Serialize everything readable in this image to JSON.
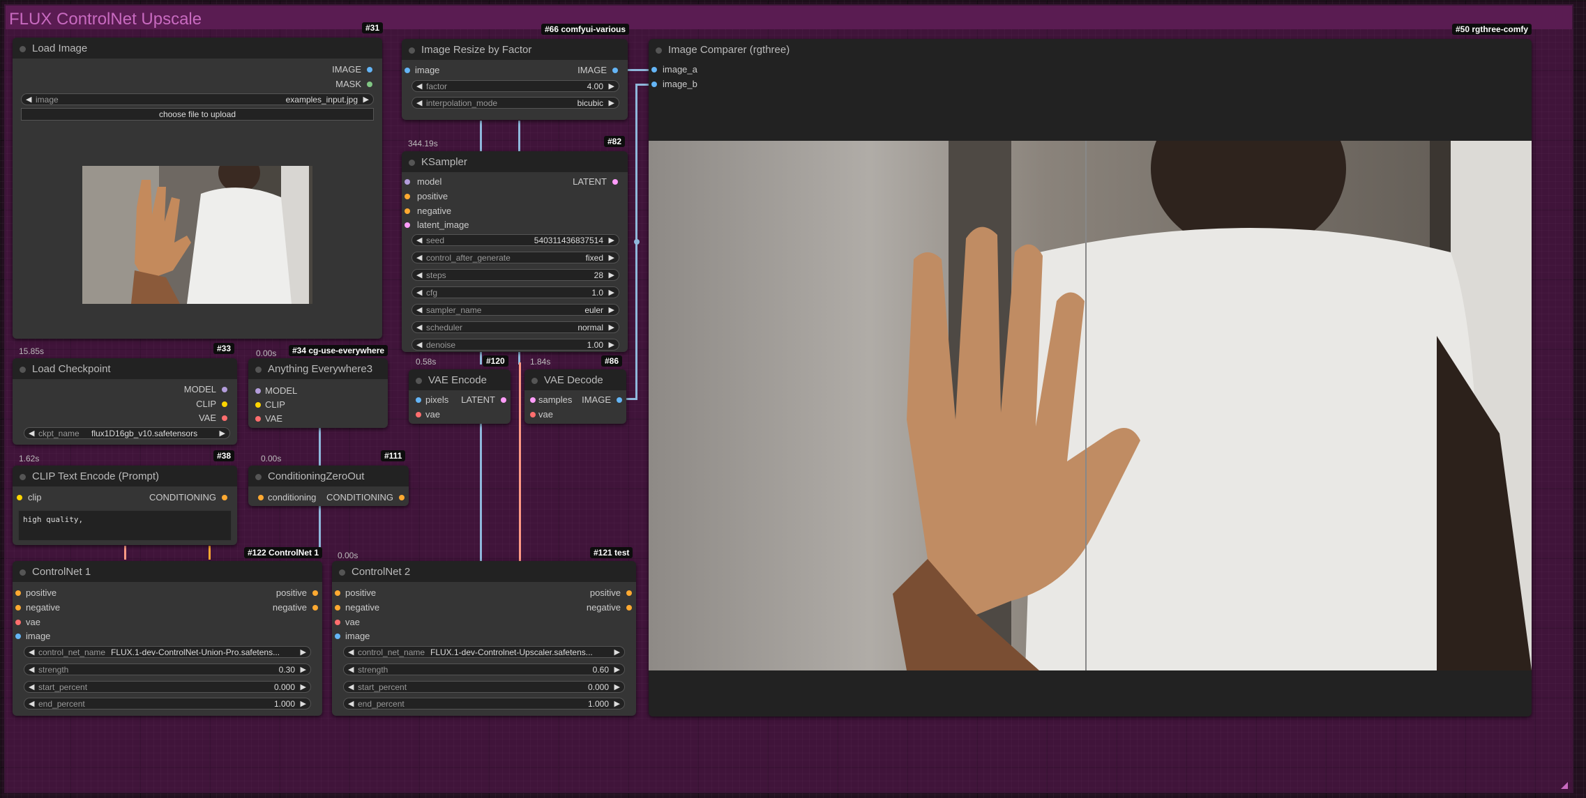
{
  "group": {
    "title": "FLUX ControlNet Upscale"
  },
  "nodes": {
    "load_image": {
      "title": "Load Image",
      "badge": "#31",
      "time": "15.85s",
      "outputs": [
        "IMAGE",
        "MASK"
      ],
      "widget_image": {
        "label": "image",
        "value": "examples_input.jpg"
      },
      "upload_label": "choose file to upload"
    },
    "resize": {
      "title": "Image Resize by Factor",
      "badge": "#66 comfyui-various",
      "input": "image",
      "output": "IMAGE",
      "factor": {
        "label": "factor",
        "value": "4.00"
      },
      "interp": {
        "label": "interpolation_mode",
        "value": "bicubic"
      }
    },
    "comparer": {
      "title": "Image Comparer (rgthree)",
      "badge": "#50 rgthree-comfy",
      "inputs": [
        "image_a",
        "image_b"
      ]
    },
    "ksampler": {
      "title": "KSampler",
      "badge": "#82",
      "time": "344.19s",
      "inputs": [
        "model",
        "positive",
        "negative",
        "latent_image"
      ],
      "output": "LATENT",
      "widgets": [
        {
          "label": "seed",
          "value": "540311436837514"
        },
        {
          "label": "control_after_generate",
          "value": "fixed"
        },
        {
          "label": "steps",
          "value": "28"
        },
        {
          "label": "cfg",
          "value": "1.0"
        },
        {
          "label": "sampler_name",
          "value": "euler"
        },
        {
          "label": "scheduler",
          "value": "normal"
        },
        {
          "label": "denoise",
          "value": "1.00"
        }
      ]
    },
    "checkpoint": {
      "title": "Load Checkpoint",
      "badge": "#33",
      "outputs": [
        "MODEL",
        "CLIP",
        "VAE"
      ],
      "ckpt": {
        "label": "ckpt_name",
        "value": "flux1D16gb_v10.safetensors"
      }
    },
    "anything": {
      "title": "Anything Everywhere3",
      "badge": "#34 cg-use-everywhere",
      "time": "0.00s",
      "inputs": [
        "MODEL",
        "CLIP",
        "VAE"
      ]
    },
    "vae_encode": {
      "title": "VAE Encode",
      "badge": "#120",
      "time": "0.58s",
      "inputs": [
        "pixels",
        "vae"
      ],
      "output": "LATENT"
    },
    "vae_decode": {
      "title": "VAE Decode",
      "badge": "#86",
      "time": "1.84s",
      "inputs": [
        "samples",
        "vae"
      ],
      "output": "IMAGE"
    },
    "clip_encode": {
      "title": "CLIP Text Encode (Prompt)",
      "badge": "#38",
      "time": "1.62s",
      "input": "clip",
      "output": "CONDITIONING",
      "text": "high quality,"
    },
    "cond_zero": {
      "title": "ConditioningZeroOut",
      "badge": "#111",
      "time": "0.00s",
      "input": "conditioning",
      "output": "CONDITIONING"
    },
    "cn1": {
      "title": "ControlNet 1",
      "badge": "#122 ControlNet 1",
      "inputs": [
        "positive",
        "negative",
        "vae",
        "image"
      ],
      "outputs": [
        "positive",
        "negative"
      ],
      "widgets": [
        {
          "label": "control_net_name",
          "value": "FLUX.1-dev-ControlNet-Union-Pro.safetens..."
        },
        {
          "label": "strength",
          "value": "0.30"
        },
        {
          "label": "start_percent",
          "value": "0.000"
        },
        {
          "label": "end_percent",
          "value": "1.000"
        }
      ]
    },
    "cn2": {
      "title": "ControlNet 2",
      "badge": "#121 test",
      "time": "0.00s",
      "inputs": [
        "positive",
        "negative",
        "vae",
        "image"
      ],
      "outputs": [
        "positive",
        "negative"
      ],
      "widgets": [
        {
          "label": "control_net_name",
          "value": "FLUX.1-dev-Controlnet-Upscaler.safetens..."
        },
        {
          "label": "strength",
          "value": "0.60"
        },
        {
          "label": "start_percent",
          "value": "0.000"
        },
        {
          "label": "end_percent",
          "value": "1.000"
        }
      ]
    }
  },
  "arrows": {
    "left": "◀",
    "right": "▶"
  },
  "colors": {
    "image": "#64b5f6",
    "mask": "#81c784",
    "model": "#b39ddb",
    "clip": "#ffd500",
    "vae": "#ff6e6e",
    "conditioning": "#ffa931",
    "latent": "#ff9cf9",
    "group": "#5a1c52"
  }
}
